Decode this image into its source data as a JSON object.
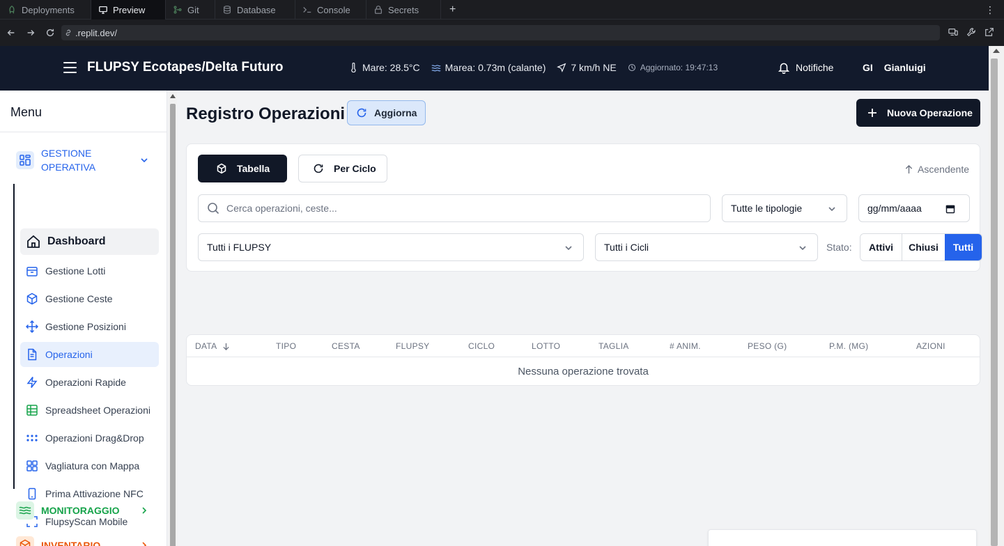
{
  "ide": {
    "tabs": [
      {
        "label": "Deployments",
        "icon": "deploy-icon"
      },
      {
        "label": "Preview",
        "icon": "monitor-icon"
      },
      {
        "label": "Git",
        "icon": "git-icon"
      },
      {
        "label": "Database",
        "icon": "database-icon"
      },
      {
        "label": "Console",
        "icon": "terminal-icon"
      },
      {
        "label": "Secrets",
        "icon": "lock-icon"
      }
    ],
    "add_tab": "+",
    "url": ".replit.dev/"
  },
  "header": {
    "title": "FLUPSY Ecotapes/Delta Futuro",
    "sea_temp": "Mare: 28.5°C",
    "tide": "Marea: 0.73m (calante)",
    "wind": "7 km/h NE",
    "updated": "Aggiornato: 19:47:13",
    "notifications": "Notifiche",
    "user_initials": "GI",
    "user_name": "Gianluigi"
  },
  "sidebar": {
    "title": "Menu",
    "groups": {
      "operativa": "GESTIONE OPERATIVA",
      "monitoraggio": "MONITORAGGIO",
      "inventario": "INVENTARIO"
    },
    "items": [
      {
        "label": "Dashboard",
        "icon": "home-icon"
      },
      {
        "label": "Gestione Lotti",
        "icon": "box-icon"
      },
      {
        "label": "Gestione Ceste",
        "icon": "cube-icon"
      },
      {
        "label": "Gestione Posizioni",
        "icon": "move-icon"
      },
      {
        "label": "Operazioni",
        "icon": "file-icon"
      },
      {
        "label": "Operazioni Rapide",
        "icon": "zap-icon"
      },
      {
        "label": "Spreadsheet Operazioni",
        "icon": "table-icon"
      },
      {
        "label": "Operazioni Drag&Drop",
        "icon": "grip-icon"
      },
      {
        "label": "Vagliatura con Mappa",
        "icon": "grid-icon"
      },
      {
        "label": "Prima Attivazione NFC",
        "icon": "phone-icon"
      },
      {
        "label": "FlupsyScan Mobile",
        "icon": "scan-icon"
      }
    ],
    "colors": {
      "operativa": "#2563eb",
      "monitoraggio": "#16a34a",
      "inventario": "#ea580c"
    }
  },
  "main": {
    "title": "Registro Operazioni",
    "refresh_label": "Aggiorna",
    "new_label": "Nuova Operazione",
    "view_tabs": {
      "table": "Tabella",
      "cycle": "Per Ciclo"
    },
    "sort_label": "Ascendente",
    "search_placeholder": "Cerca operazioni, ceste...",
    "type_filter": "Tutte le tipologie",
    "date_placeholder": "gg/mm/aaaa",
    "flupsy_filter": "Tutti i FLUPSY",
    "cycle_filter": "Tutti i Cicli",
    "state_label": "Stato:",
    "state_options": [
      "Attivi",
      "Chiusi",
      "Tutti"
    ],
    "state_selected": "Tutti",
    "columns": [
      "DATA",
      "TIPO",
      "CESTA",
      "FLUPSY",
      "CICLO",
      "LOTTO",
      "TAGLIA",
      "# ANIM.",
      "PESO (G)",
      "P.M. (MG)",
      "AZIONI"
    ],
    "empty_message": "Nessuna operazione trovata"
  }
}
